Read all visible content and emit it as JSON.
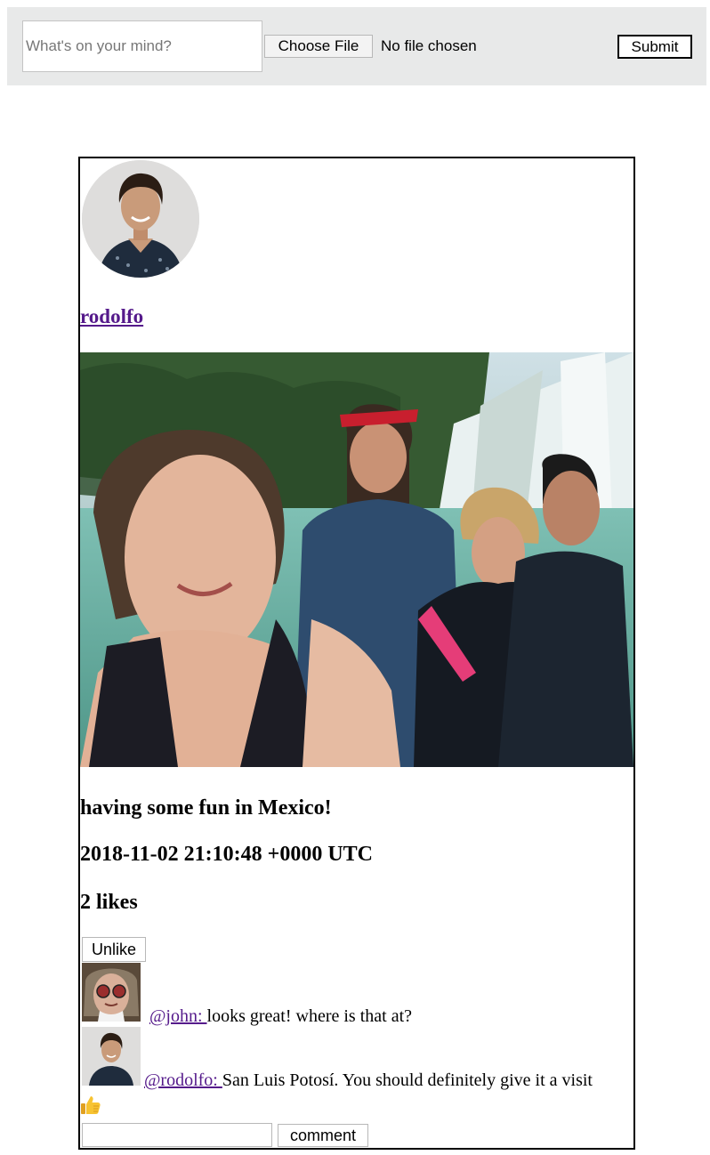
{
  "composer": {
    "status_placeholder": "What's on your mind?",
    "choose_file_label": "Choose File",
    "file_status": "No file chosen",
    "submit_label": "Submit"
  },
  "post": {
    "username": "rodolfo",
    "caption": "having some fun in Mexico!",
    "timestamp": "2018-11-02 21:10:48 +0000 UTC",
    "likes": "2 likes",
    "unlike_label": "Unlike",
    "comments": [
      {
        "user": "@john: ",
        "text": "looks great! where is that at?"
      },
      {
        "user": "@rodolfo: ",
        "text": "San Luis Potosí. You should definitely give it a visit"
      }
    ],
    "thumbs_icon": "thumbs-up-icon",
    "comment_button_label": "comment"
  },
  "colors": {
    "topbar_bg": "#e8e9e9",
    "link": "#551a8b",
    "card_border": "#000000"
  }
}
